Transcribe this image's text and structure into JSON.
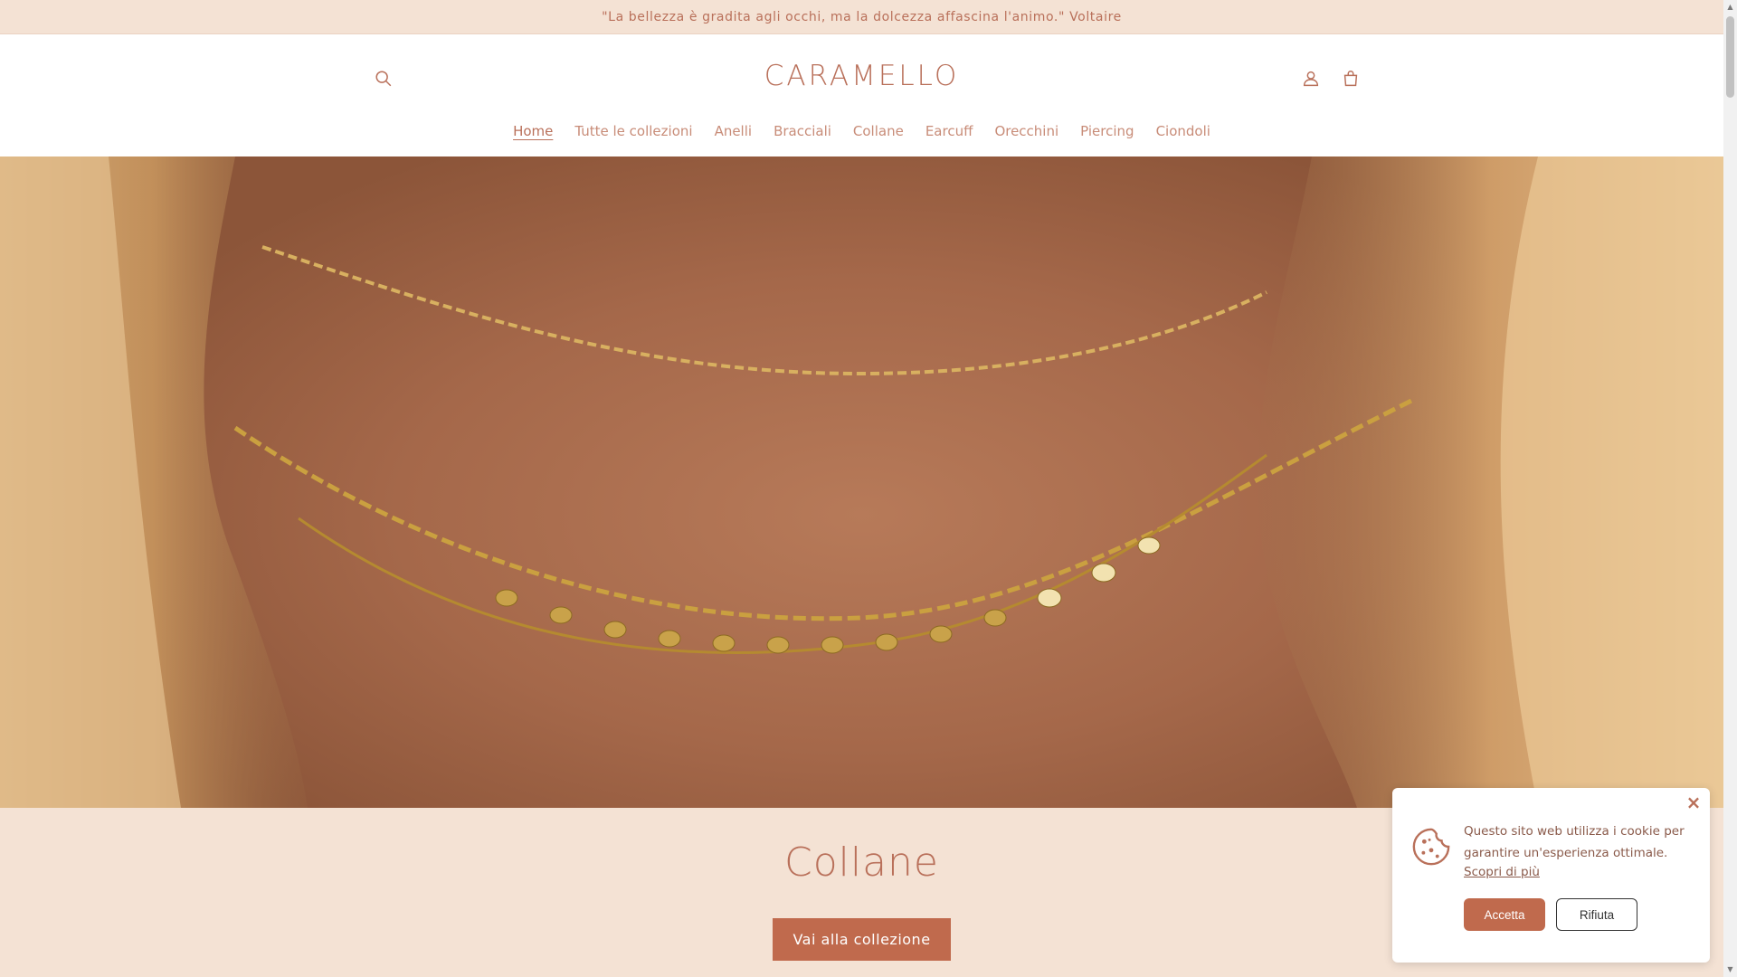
{
  "announcement": {
    "text": "\"La bellezza è gradita agli occhi, ma la dolcezza affascina l'animo.\" Voltaire"
  },
  "header": {
    "logo": "CARAMELLO",
    "icons": {
      "search": "search-icon",
      "account": "account-icon",
      "cart": "cart-icon"
    }
  },
  "nav": {
    "items": [
      {
        "label": "Home",
        "active": true
      },
      {
        "label": "Tutte le collezioni",
        "active": false
      },
      {
        "label": "Anelli",
        "active": false
      },
      {
        "label": "Bracciali",
        "active": false
      },
      {
        "label": "Collane",
        "active": false
      },
      {
        "label": "Earcuff",
        "active": false
      },
      {
        "label": "Orecchini",
        "active": false
      },
      {
        "label": "Piercing",
        "active": false
      },
      {
        "label": "Ciondoli",
        "active": false
      }
    ]
  },
  "hero": {
    "image_alt": "necklaces-photo",
    "title": "Collane",
    "cta_label": "Vai alla collezione"
  },
  "cookie_banner": {
    "text": "Questo sito web utilizza i cookie per garantire un'esperienza ottimale.",
    "link": "Scopri di più",
    "accept_label": "Accetta",
    "reject_label": "Rifiuta",
    "close_icon": "close-icon",
    "cookie_icon": "cookie-icon"
  },
  "colors": {
    "accent": "#c06a4d",
    "text": "#b9705a",
    "background": "#f4e2d4"
  }
}
